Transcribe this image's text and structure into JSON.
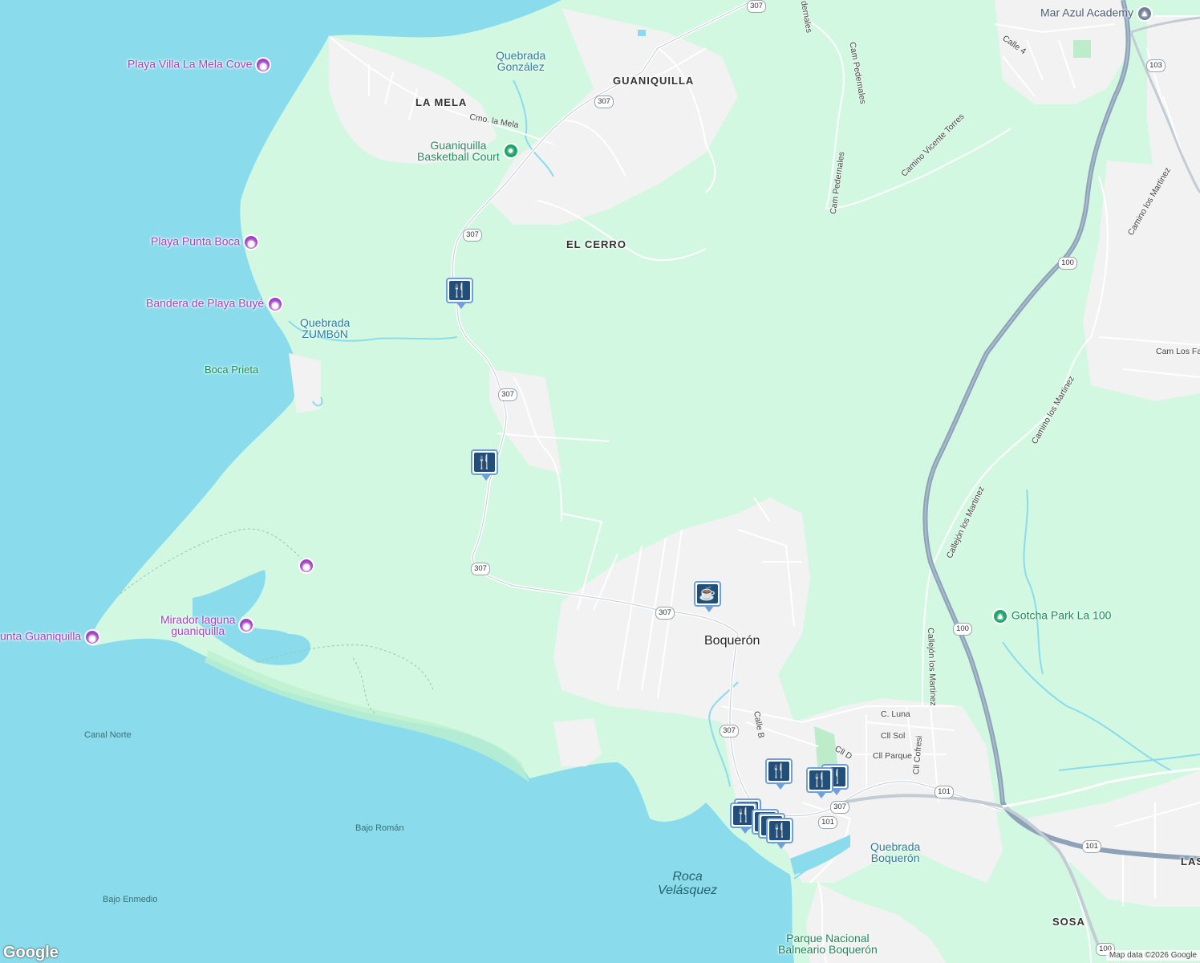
{
  "colors": {
    "water": "#8adcec",
    "land": "#d3f8e2",
    "urban": "#f2f2f2",
    "road": "#ffffff",
    "highway": "#8da2b8",
    "poi": "#a142c4",
    "restaurant_pin": "#1f4f7a"
  },
  "places": {
    "la_mela": "LA MELA",
    "guaniquilla": "GUANIQUILLA",
    "el_cerro": "EL CERRO",
    "boqueron": "Boquerón",
    "sosa": "SOSA",
    "las": "LAS"
  },
  "water": {
    "canal_norte": "Canal Norte",
    "bajo_roman": "Bajo Román",
    "bajo_enmedio": "Bajo Enmedio",
    "boca_prieta": "Boca Prieta",
    "roca_velasquez": "Roca\nVelásquez"
  },
  "streams": {
    "quebrada_gonzalez": "Quebrada\nGonzález",
    "quebrada_zumbon": "Quebrada\nZUMBóN",
    "quebrada_boqueron": "Quebrada\nBoquerón"
  },
  "pois": {
    "playa_villa_la_mela": "Playa Villa La Mela Cove",
    "playa_punta_boca": "Playa Punta Boca",
    "bandera_playa_buye": "Bandera de Playa Buyé",
    "mirador_laguna": "Mirador laguna\nguaniquilla",
    "punta_guaniquilla": "unta Guaniquilla",
    "guaniquilla_court": "Guaniquilla\nBasketball Court",
    "gotcha_park": "Gotcha Park La 100",
    "mar_azul": "Mar Azul Academy",
    "parque_nacional": "Parque Nacional\nBalneario Boquerón"
  },
  "streets": {
    "cmo_la_mela": "Cmo. la Mela",
    "cam_pedernales_1": "Cam Pedernales",
    "cam_pedernales_2": "Cam Pedernales",
    "pedernales_top": "dernales",
    "camino_vicente_torres": "Camino Vicente Torres",
    "calle_4": "Calle 4",
    "camino_los_martinez_1": "Camino los Martinez",
    "camino_los_martinez_2": "Camino los Martinez",
    "cam_los_fa": "Cam Los Fa",
    "callejon_los_martinez_1": "Callejón los Martinez",
    "callejon_los_martinez_2": "Callejón los Martinez",
    "c_luna": "C. Luna",
    "cll_sol": "Cll Sol",
    "cll_parque": "Cll Parque",
    "cll_d": "Cll D",
    "calle_b": "Calle B",
    "cll_cofresi": "Cll Cofresi"
  },
  "shields": {
    "r307_a": "307",
    "r307_b": "307",
    "r307_c": "307",
    "r307_d": "307",
    "r307_e": "307",
    "r307_f": "307",
    "r307_g": "307",
    "r307_h": "307",
    "r100_a": "100",
    "r100_b": "100",
    "r100_c": "100",
    "r101_a": "101",
    "r101_b": "101",
    "r101_c": "101",
    "r103": "103"
  },
  "icons": {
    "restaurant": "🍴",
    "cafe": "☕",
    "camera": "◉",
    "tree": "▲",
    "school": "▲",
    "pin": "●"
  },
  "logo": "Google",
  "attribution": "Map data ©2026 Google"
}
